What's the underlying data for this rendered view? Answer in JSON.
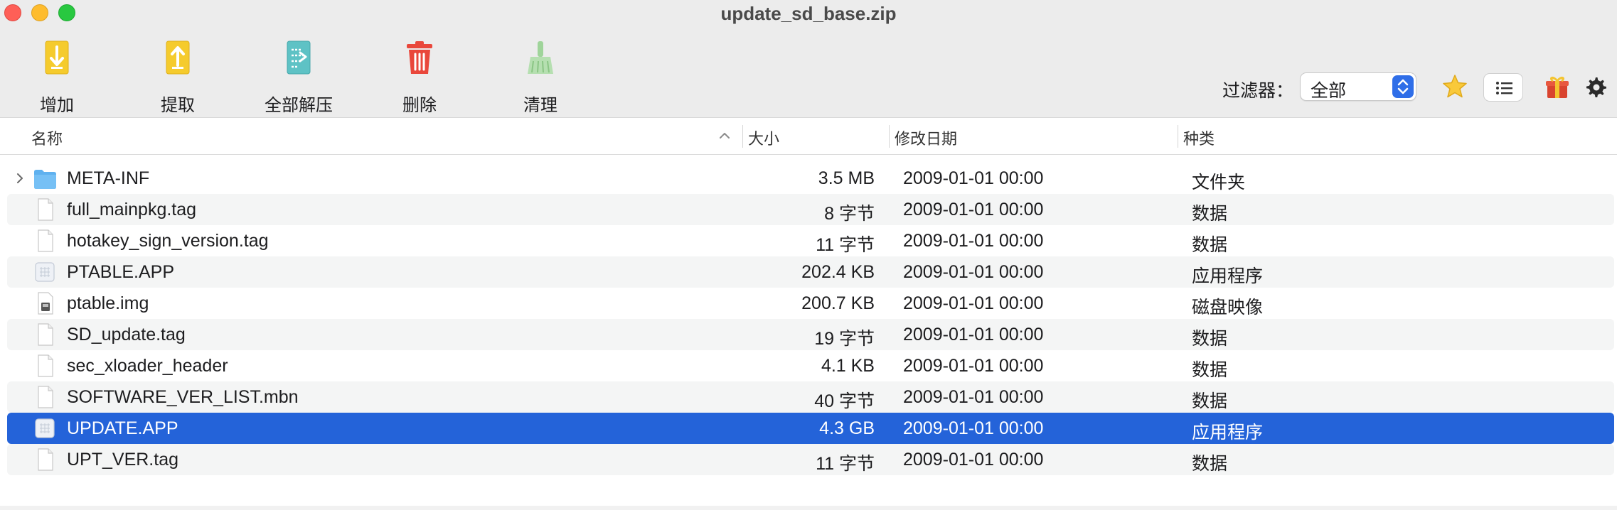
{
  "window": {
    "title": "update_sd_base.zip"
  },
  "toolbar": {
    "add": "增加",
    "extract": "提取",
    "extract_all": "全部解压",
    "delete": "删除",
    "clean": "清理"
  },
  "filter": {
    "label": "过滤器：",
    "value": "全部"
  },
  "columns": {
    "name": "名称",
    "size": "大小",
    "modified": "修改日期",
    "kind": "种类"
  },
  "files": [
    {
      "name": "META-INF",
      "size": "3.5 MB",
      "date": "2009-01-01 00:00",
      "kind": "文件夹",
      "icon": "folder-icon",
      "expandable": true
    },
    {
      "name": "full_mainpkg.tag",
      "size": "8 字节",
      "date": "2009-01-01 00:00",
      "kind": "数据",
      "icon": "document-icon"
    },
    {
      "name": "hotakey_sign_version.tag",
      "size": "11 字节",
      "date": "2009-01-01 00:00",
      "kind": "数据",
      "icon": "document-icon"
    },
    {
      "name": "PTABLE.APP",
      "size": "202.4 KB",
      "date": "2009-01-01 00:00",
      "kind": "应用程序",
      "icon": "application-icon"
    },
    {
      "name": "ptable.img",
      "size": "200.7 KB",
      "date": "2009-01-01 00:00",
      "kind": "磁盘映像",
      "icon": "disk-image-icon"
    },
    {
      "name": "SD_update.tag",
      "size": "19 字节",
      "date": "2009-01-01 00:00",
      "kind": "数据",
      "icon": "document-icon"
    },
    {
      "name": "sec_xloader_header",
      "size": "4.1 KB",
      "date": "2009-01-01 00:00",
      "kind": "数据",
      "icon": "document-icon"
    },
    {
      "name": "SOFTWARE_VER_LIST.mbn",
      "size": "40 字节",
      "date": "2009-01-01 00:00",
      "kind": "数据",
      "icon": "document-icon"
    },
    {
      "name": "UPDATE.APP",
      "size": "4.3 GB",
      "date": "2009-01-01 00:00",
      "kind": "应用程序",
      "icon": "application-icon",
      "selected": true
    },
    {
      "name": "UPT_VER.tag",
      "size": "11 字节",
      "date": "2009-01-01 00:00",
      "kind": "数据",
      "icon": "document-icon"
    }
  ],
  "colors": {
    "selection": "#2463d9",
    "accent": "#2f6ee8"
  }
}
